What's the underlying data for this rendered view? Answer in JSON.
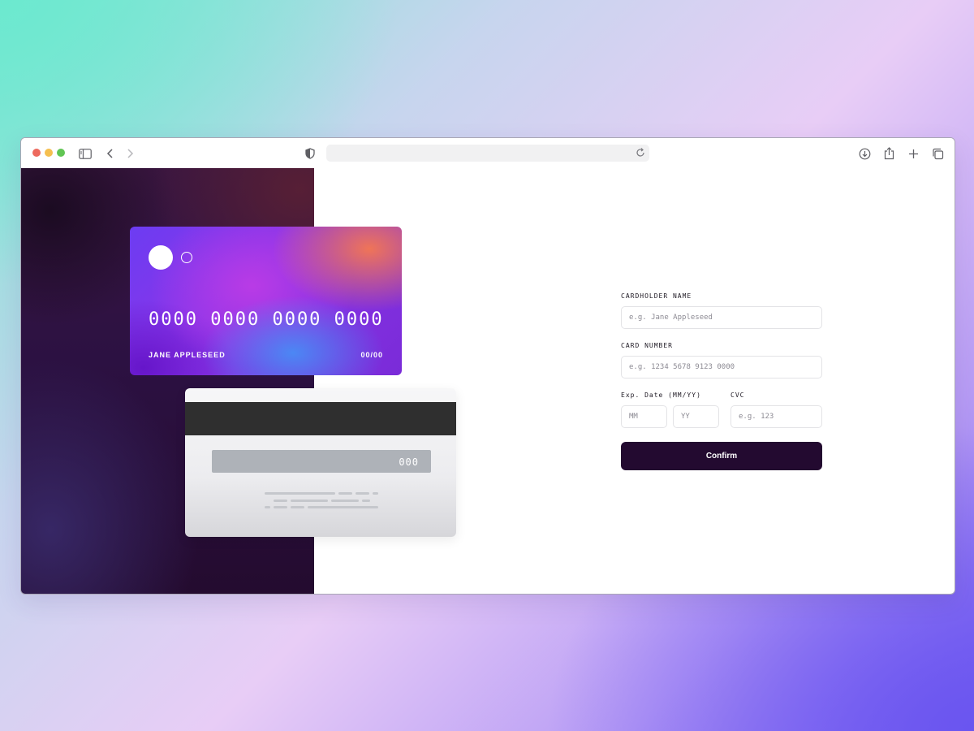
{
  "browser": {
    "traffic_lights": {
      "close": "#ed6a5e",
      "minimize": "#f5bf4f",
      "maximize": "#61c554"
    },
    "icons": {
      "sidebar": "sidebar-icon",
      "back": "chevron-left-icon",
      "forward": "chevron-right-icon",
      "privacy": "shield-icon",
      "reload": "reload-icon",
      "download": "download-icon",
      "share": "share-icon",
      "new_tab": "plus-icon",
      "tabs": "tabs-overview-icon"
    },
    "url": ""
  },
  "card_front": {
    "number": "0000 0000 0000 0000",
    "name": "JANE APPLESEED",
    "expiry": "00/00"
  },
  "card_back": {
    "cvc": "000"
  },
  "form": {
    "cardholder_label": "CARDHOLDER NAME",
    "cardholder_placeholder": "e.g. Jane Appleseed",
    "number_label": "CARD NUMBER",
    "number_placeholder": "e.g. 1234 5678 9123 0000",
    "exp_label": "Exp. Date (MM/YY)",
    "mm_placeholder": "MM",
    "yy_placeholder": "YY",
    "cvc_label": "CVC",
    "cvc_placeholder": "e.g. 123",
    "confirm_label": "Confirm"
  },
  "colors": {
    "accent": "#230a30",
    "left_panel": "#2c1142"
  }
}
